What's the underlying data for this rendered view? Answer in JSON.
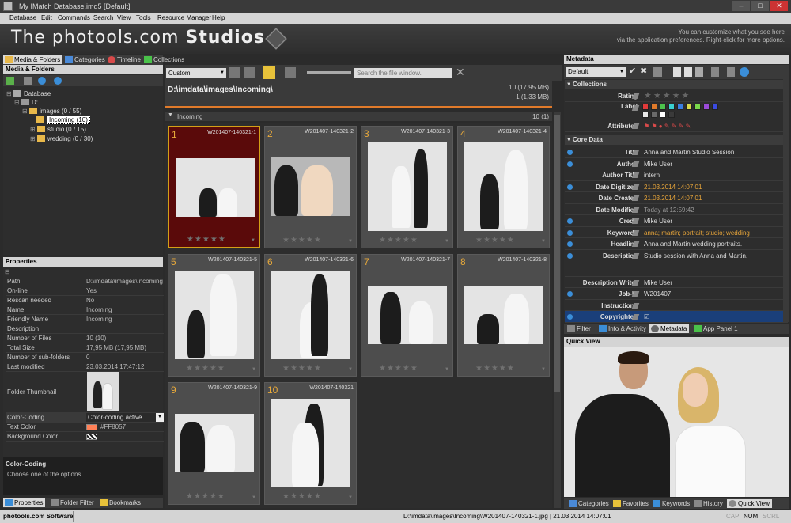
{
  "window": {
    "title": "My IMatch Database.imd5 [Default]",
    "btn_min": "–",
    "btn_max": "□",
    "btn_close": "✕"
  },
  "menu": [
    "Database",
    "Edit",
    "Commands",
    "Search",
    "View",
    "Tools",
    "Resource Manager",
    "Help"
  ],
  "banner": {
    "title_light": "The photools.com",
    "title_bold": "Studios",
    "hint_line1": "You can customize what you see here",
    "hint_line2": "via the application preferences. Right-click for more options."
  },
  "left_tabs": [
    "Media & Folders",
    "Categories",
    "Timeline",
    "Collections"
  ],
  "left_panel": {
    "header": "Media & Folders"
  },
  "tree": {
    "database": "Database",
    "drive": "D:",
    "images": "images (0 / 55)",
    "incoming": "Incoming (10)",
    "studio": "studio (0 / 15)",
    "wedding": "wedding (0 / 30)"
  },
  "properties": {
    "header": "Properties",
    "rows": [
      {
        "k": "Path",
        "v": "D:\\imdata\\images\\Incoming"
      },
      {
        "k": "On-line",
        "v": "Yes"
      },
      {
        "k": "Rescan needed",
        "v": "No"
      },
      {
        "k": "Name",
        "v": "Incoming"
      },
      {
        "k": "Friendly Name",
        "v": "Incoming"
      },
      {
        "k": "Description",
        "v": ""
      },
      {
        "k": "Number of Files",
        "v": "10 (10)"
      },
      {
        "k": "Total Size",
        "v": "17,95 MB (17,95 MB)"
      },
      {
        "k": "Number of sub-folders",
        "v": "0"
      },
      {
        "k": "Last modified",
        "v": "23.03.2014 17:47:12"
      }
    ],
    "thumb_label": "Folder Thumbnail",
    "color_coding_k": "Color-Coding",
    "color_coding_v": "Color-coding active",
    "text_color_k": "Text Color",
    "text_color_v": "#FF8057",
    "bg_color_k": "Background Color",
    "help_title": "Color-Coding",
    "help_text": "Choose one of the options"
  },
  "left_bottom_tabs": [
    "Properties",
    "Folder Filter",
    "Bookmarks"
  ],
  "toolbar": {
    "layout": "Custom",
    "search_placeholder": "Search the file window."
  },
  "file_window": {
    "path": "D:\\imdata\\images\\Incoming\\",
    "count1": "10 (17,95 MB)",
    "count2": "1 (1,33 MB)",
    "group": "Incoming",
    "group_count": "10 (1)"
  },
  "thumbs": [
    {
      "num": "1",
      "name": "W201407-140321-1"
    },
    {
      "num": "2",
      "name": "W201407-140321-2"
    },
    {
      "num": "3",
      "name": "W201407-140321-3"
    },
    {
      "num": "4",
      "name": "W201407-140321-4"
    },
    {
      "num": "5",
      "name": "W201407-140321-5"
    },
    {
      "num": "6",
      "name": "W201407-140321-6"
    },
    {
      "num": "7",
      "name": "W201407-140321-7"
    },
    {
      "num": "8",
      "name": "W201407-140321-8"
    },
    {
      "num": "9",
      "name": "W201407-140321-9"
    },
    {
      "num": "10",
      "name": "W201407-140321"
    }
  ],
  "stars": "★★★★★",
  "metadata": {
    "header": "Metadata",
    "preset": "Default",
    "section_collections": "Collections",
    "rating_k": "Rating",
    "label_k": "Label",
    "attributes_k": "Attributes",
    "section_core": "Core Data",
    "rows": [
      {
        "k": "Title",
        "v": "Anna and Martin Studio Session",
        "c": ""
      },
      {
        "k": "Author",
        "v": "Mike User",
        "c": ""
      },
      {
        "k": "Author Title",
        "v": "intern",
        "c": ""
      },
      {
        "k": "Date Digitized",
        "v": "21.03.2014 14:07:01",
        "c": "orange"
      },
      {
        "k": "Date Created",
        "v": "21.03.2014 14:07:01",
        "c": "orange"
      },
      {
        "k": "Date Modified",
        "v": "Today at 12:59:42",
        "c": "grey"
      },
      {
        "k": "Credit",
        "v": "Mike User",
        "c": ""
      },
      {
        "k": "Keywords",
        "v": "anna; martin; portrait; studio; wedding",
        "c": "orange"
      },
      {
        "k": "Headline",
        "v": "Anna and Martin wedding portraits.",
        "c": ""
      },
      {
        "k": "Description",
        "v": "Studio session with Anna and Martin.",
        "c": ""
      },
      {
        "k": "Description Writer",
        "v": "Mike User",
        "c": ""
      },
      {
        "k": "Job-Id",
        "v": "W201407",
        "c": ""
      },
      {
        "k": "Instructions",
        "v": "",
        "c": ""
      },
      {
        "k": "Copyrighted",
        "v": "☑",
        "c": ""
      }
    ],
    "label_colors": [
      "#e03a3a",
      "#e07a2a",
      "#4cc24c",
      "#3ad0d0",
      "#3a7de0",
      "#d8d84a",
      "#7ad84a",
      "#9a4ad8",
      "#3a4ae0",
      "#e8e8e8",
      "#6a6a6a",
      "#ffffff",
      "#3a3a3a"
    ]
  },
  "right_mid_tabs": [
    "Filter",
    "Info & Activity",
    "Metadata",
    "App Panel 1"
  ],
  "quick_view": {
    "header": "Quick View"
  },
  "right_bottom_tabs": [
    "Categories",
    "Favorites",
    "Keywords",
    "History",
    "Quick View"
  ],
  "status": {
    "brand": "photools.com Software",
    "file": "D:\\imdata\\images\\Incoming\\W201407-140321-1.jpg | 21.03.2014 14:07:01",
    "cap": "CAP",
    "num": "NUM",
    "scrl": "SCRL"
  }
}
